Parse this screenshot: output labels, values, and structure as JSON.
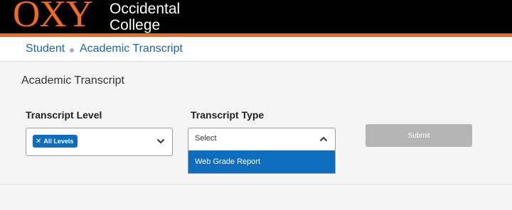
{
  "header": {
    "logo_mark": "OXY",
    "logo_line1": "Occidental",
    "logo_line2": "College",
    "brand_color": "#f26a21"
  },
  "breadcrumb": {
    "items": [
      "Student",
      "Academic Transcript"
    ]
  },
  "page": {
    "title": "Academic Transcript"
  },
  "form": {
    "transcript_level": {
      "label": "Transcript Level",
      "selected_chip": "All Levels",
      "chip_remove_icon": "close-icon",
      "toggle_icon": "chevron-down-icon"
    },
    "transcript_type": {
      "label": "Transcript Type",
      "value": "Select",
      "toggle_icon": "chevron-up-icon",
      "options": [
        "Web Grade Report"
      ]
    },
    "submit_label": "Submit"
  },
  "colors": {
    "accent": "#0f6dbf",
    "link": "#1a65a6",
    "disabled": "#b5b5b5"
  }
}
